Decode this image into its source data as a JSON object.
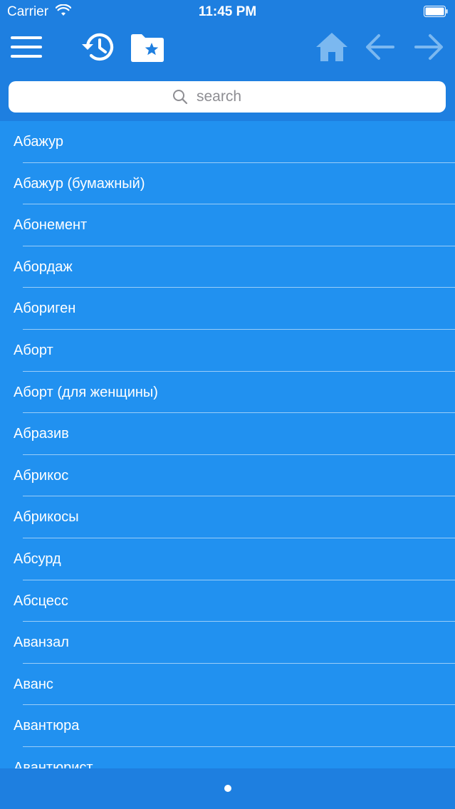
{
  "status": {
    "carrier": "Carrier",
    "time": "11:45 PM"
  },
  "toolbar": {
    "menu_icon": "hamburger-menu-icon",
    "history_icon": "history-icon",
    "favorites_icon": "favorites-folder-icon",
    "home_icon": "home-icon",
    "back_icon": "arrow-left-icon",
    "forward_icon": "arrow-right-icon",
    "active_color": "#FFFFFF",
    "disabled_color": "#7BB8F0"
  },
  "search": {
    "placeholder": "search"
  },
  "list": {
    "items": [
      "Абажур",
      "Абажур (бумажный)",
      "Абонемент",
      "Абордаж",
      "Абориген",
      "Аборт",
      "Аборт (для женщины)",
      "Абразив",
      "Абрикос",
      "Абрикосы",
      "Абсурд",
      "Абсцесс",
      "Аванзал",
      "Аванс",
      "Авантюра",
      "Авантюрист"
    ]
  },
  "pager": {
    "current_page": 1,
    "total_pages": 1
  },
  "colors": {
    "header_bg": "#1E7FE0",
    "list_bg": "#2191F0"
  }
}
